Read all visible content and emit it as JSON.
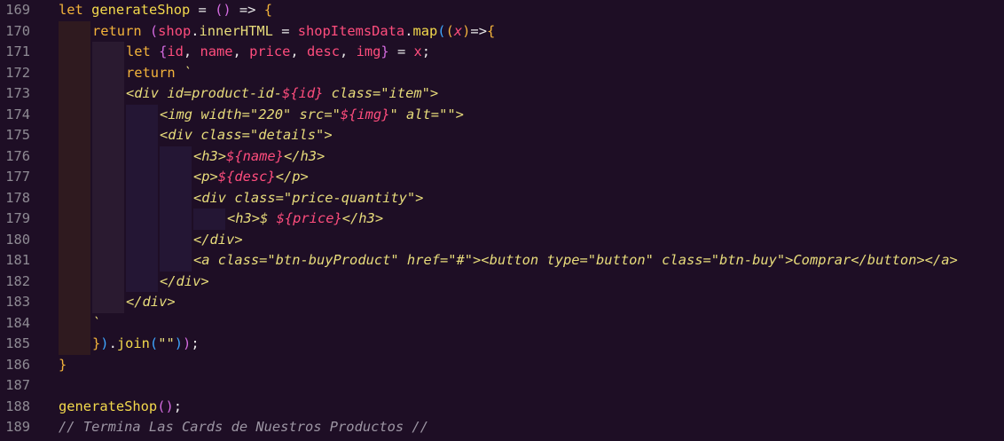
{
  "editor": {
    "language": "javascript",
    "theme_colors": {
      "background": "#1e0e25",
      "line_number": "#8e8a93",
      "keyword": "#f3b33b",
      "function": "#f3d94c",
      "variable": "#ff4d7d",
      "string": "#e8dc7b",
      "bracket_purple": "#d46be0",
      "bracket_blue": "#3ea6ff",
      "comment": "#9c95a3",
      "indent_guide_1": "#2f1a1f",
      "indent_guide_2": "#2a1a30",
      "indent_guide_3": "#241634"
    },
    "lines": [
      {
        "num": "169",
        "indent": 0,
        "tokens": [
          {
            "t": "let ",
            "c": "kw"
          },
          {
            "t": "generateShop",
            "c": "fn"
          },
          {
            "t": " = ",
            "c": "op"
          },
          {
            "t": "()",
            "c": "paren"
          },
          {
            "t": " => ",
            "c": "op"
          },
          {
            "t": "{",
            "c": "brace"
          }
        ]
      },
      {
        "num": "170",
        "indent": 1,
        "tokens": [
          {
            "t": "return ",
            "c": "kw"
          },
          {
            "t": "(",
            "c": "paren"
          },
          {
            "t": "shop",
            "c": "var"
          },
          {
            "t": ".",
            "c": "pl"
          },
          {
            "t": "innerHTML",
            "c": "prop"
          },
          {
            "t": " = ",
            "c": "op"
          },
          {
            "t": "shopItemsData",
            "c": "var"
          },
          {
            "t": ".",
            "c": "pl"
          },
          {
            "t": "map",
            "c": "fn"
          },
          {
            "t": "(",
            "c": "paren2"
          },
          {
            "t": "(",
            "c": "brace"
          },
          {
            "t": "x",
            "c": "interp"
          },
          {
            "t": ")",
            "c": "brace"
          },
          {
            "t": "=>",
            "c": "op"
          },
          {
            "t": "{",
            "c": "brace"
          }
        ]
      },
      {
        "num": "171",
        "indent": 2,
        "tokens": [
          {
            "t": "let ",
            "c": "kw"
          },
          {
            "t": "{",
            "c": "paren"
          },
          {
            "t": "id",
            "c": "var"
          },
          {
            "t": ", ",
            "c": "pl"
          },
          {
            "t": "name",
            "c": "var"
          },
          {
            "t": ", ",
            "c": "pl"
          },
          {
            "t": "price",
            "c": "var"
          },
          {
            "t": ", ",
            "c": "pl"
          },
          {
            "t": "desc",
            "c": "var"
          },
          {
            "t": ", ",
            "c": "pl"
          },
          {
            "t": "img",
            "c": "var"
          },
          {
            "t": "}",
            "c": "paren"
          },
          {
            "t": " = ",
            "c": "op"
          },
          {
            "t": "x",
            "c": "var"
          },
          {
            "t": ";",
            "c": "pl"
          }
        ]
      },
      {
        "num": "172",
        "indent": 2,
        "tokens": [
          {
            "t": "return ",
            "c": "kw"
          },
          {
            "t": "`",
            "c": "str"
          }
        ]
      },
      {
        "num": "173",
        "indent": 2,
        "tokens": [
          {
            "t": "<div id=product-id-",
            "c": "tag"
          },
          {
            "t": "${id}",
            "c": "interp"
          },
          {
            "t": " class=\"item\">",
            "c": "tag"
          }
        ]
      },
      {
        "num": "174",
        "indent": 3,
        "tokens": [
          {
            "t": "<img width=\"220\" src=\"",
            "c": "tag"
          },
          {
            "t": "${img}",
            "c": "interp"
          },
          {
            "t": "\" alt=\"\">",
            "c": "tag"
          }
        ]
      },
      {
        "num": "175",
        "indent": 3,
        "tokens": [
          {
            "t": "<div class=\"details\">",
            "c": "tag"
          }
        ]
      },
      {
        "num": "176",
        "indent": 4,
        "tokens": [
          {
            "t": "<h3>",
            "c": "tag"
          },
          {
            "t": "${name}",
            "c": "interp"
          },
          {
            "t": "</h3>",
            "c": "tag"
          }
        ]
      },
      {
        "num": "177",
        "indent": 4,
        "tokens": [
          {
            "t": "<p>",
            "c": "tag"
          },
          {
            "t": "${desc}",
            "c": "interp"
          },
          {
            "t": "</p>",
            "c": "tag"
          }
        ]
      },
      {
        "num": "178",
        "indent": 4,
        "tokens": [
          {
            "t": "<div class=\"price-quantity\">",
            "c": "tag"
          }
        ]
      },
      {
        "num": "179",
        "indent": 5,
        "tokens": [
          {
            "t": "<h3>$ ",
            "c": "tag"
          },
          {
            "t": "${price}",
            "c": "interp"
          },
          {
            "t": "</h3>",
            "c": "tag"
          }
        ]
      },
      {
        "num": "180",
        "indent": 4,
        "tokens": [
          {
            "t": "</div>",
            "c": "tag"
          }
        ]
      },
      {
        "num": "181",
        "indent": 4,
        "tokens": [
          {
            "t": "<a class=\"btn-buyProduct\" href=\"#\"><button type=\"button\" class=\"btn-buy\">Comprar</button></a>",
            "c": "tag"
          }
        ]
      },
      {
        "num": "182",
        "indent": 3,
        "tokens": [
          {
            "t": "</div>",
            "c": "tag"
          }
        ]
      },
      {
        "num": "183",
        "indent": 2,
        "tokens": [
          {
            "t": "</div>",
            "c": "tag"
          }
        ]
      },
      {
        "num": "184",
        "indent": 1,
        "tokens": [
          {
            "t": "`",
            "c": "str"
          }
        ]
      },
      {
        "num": "185",
        "indent": 1,
        "tokens": [
          {
            "t": "}",
            "c": "brace"
          },
          {
            "t": ")",
            "c": "paren2"
          },
          {
            "t": ".",
            "c": "pl"
          },
          {
            "t": "join",
            "c": "fn"
          },
          {
            "t": "(",
            "c": "paren2"
          },
          {
            "t": "\"\"",
            "c": "str"
          },
          {
            "t": ")",
            "c": "paren2"
          },
          {
            "t": ")",
            "c": "paren"
          },
          {
            "t": ";",
            "c": "pl"
          }
        ]
      },
      {
        "num": "186",
        "indent": 0,
        "tokens": [
          {
            "t": "}",
            "c": "brace"
          }
        ]
      },
      {
        "num": "187",
        "indent": 0,
        "tokens": []
      },
      {
        "num": "188",
        "indent": 0,
        "tokens": [
          {
            "t": "generateShop",
            "c": "fn"
          },
          {
            "t": "()",
            "c": "paren"
          },
          {
            "t": ";",
            "c": "pl"
          }
        ]
      },
      {
        "num": "189",
        "indent": 0,
        "tokens": [
          {
            "t": "// Termina Las Cards de Nuestros Productos //",
            "c": "cmt"
          }
        ]
      }
    ]
  }
}
